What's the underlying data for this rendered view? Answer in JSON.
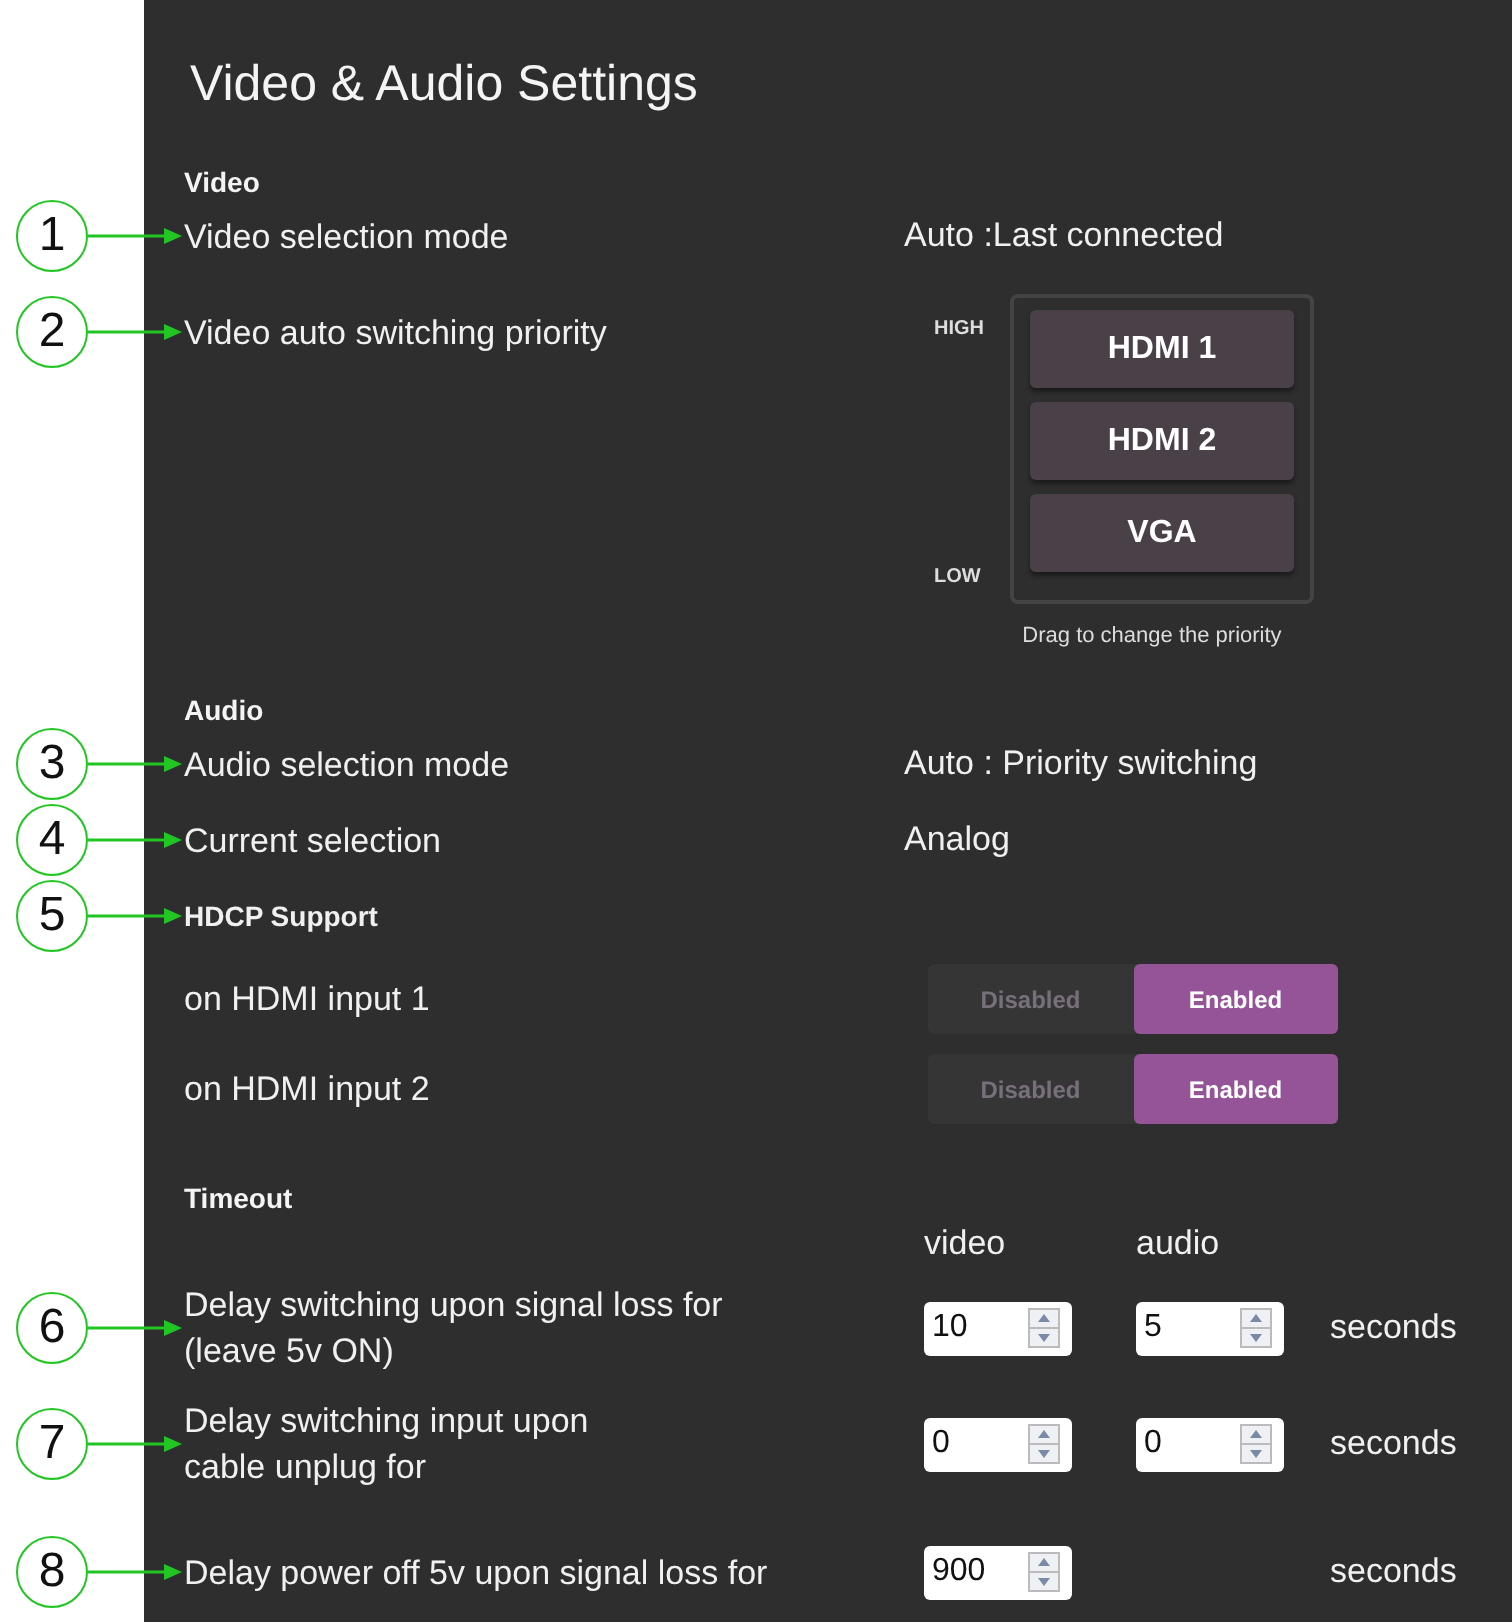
{
  "title": "Video & Audio Settings",
  "video": {
    "heading": "Video",
    "selection_mode": {
      "callout": "1",
      "label": "Video selection mode",
      "value": "Auto :Last connected"
    },
    "priority": {
      "callout": "2",
      "label": "Video auto switching priority",
      "high_label": "HIGH",
      "low_label": "LOW",
      "items": [
        "HDMI 1",
        "HDMI 2",
        "VGA"
      ],
      "hint": "Drag to change the priority"
    }
  },
  "audio": {
    "heading": "Audio",
    "rows": [
      {
        "callout": "3",
        "label": "Audio selection mode",
        "value": "Auto : Priority switching"
      },
      {
        "callout": "4",
        "label": "Current selection",
        "value": "Analog"
      }
    ]
  },
  "hdcp": {
    "callout": "5",
    "heading": "HDCP Support",
    "inputs": [
      {
        "label": "on HDMI input 1",
        "options": [
          {
            "label": "Disabled",
            "selected": false
          },
          {
            "label": "Enabled",
            "selected": true
          }
        ]
      },
      {
        "label": "on HDMI input 2",
        "options": [
          {
            "label": "Disabled",
            "selected": false
          },
          {
            "label": "Enabled",
            "selected": true
          }
        ]
      }
    ]
  },
  "timeout": {
    "heading": "Timeout",
    "columns": [
      "video",
      "audio"
    ],
    "rows": [
      {
        "callout": "6",
        "label_lines": [
          "Delay switching upon signal loss for",
          "(leave 5v ON)"
        ],
        "fields": [
          "10",
          "5"
        ],
        "unit": "seconds"
      },
      {
        "callout": "7",
        "label_lines": [
          "Delay switching input upon",
          "cable unplug for"
        ],
        "fields": [
          "0",
          "0"
        ],
        "unit": "seconds"
      },
      {
        "callout": "8",
        "label_lines": [
          "Delay power off 5v upon signal loss for"
        ],
        "fields": [
          "900"
        ],
        "unit": "seconds"
      }
    ]
  }
}
